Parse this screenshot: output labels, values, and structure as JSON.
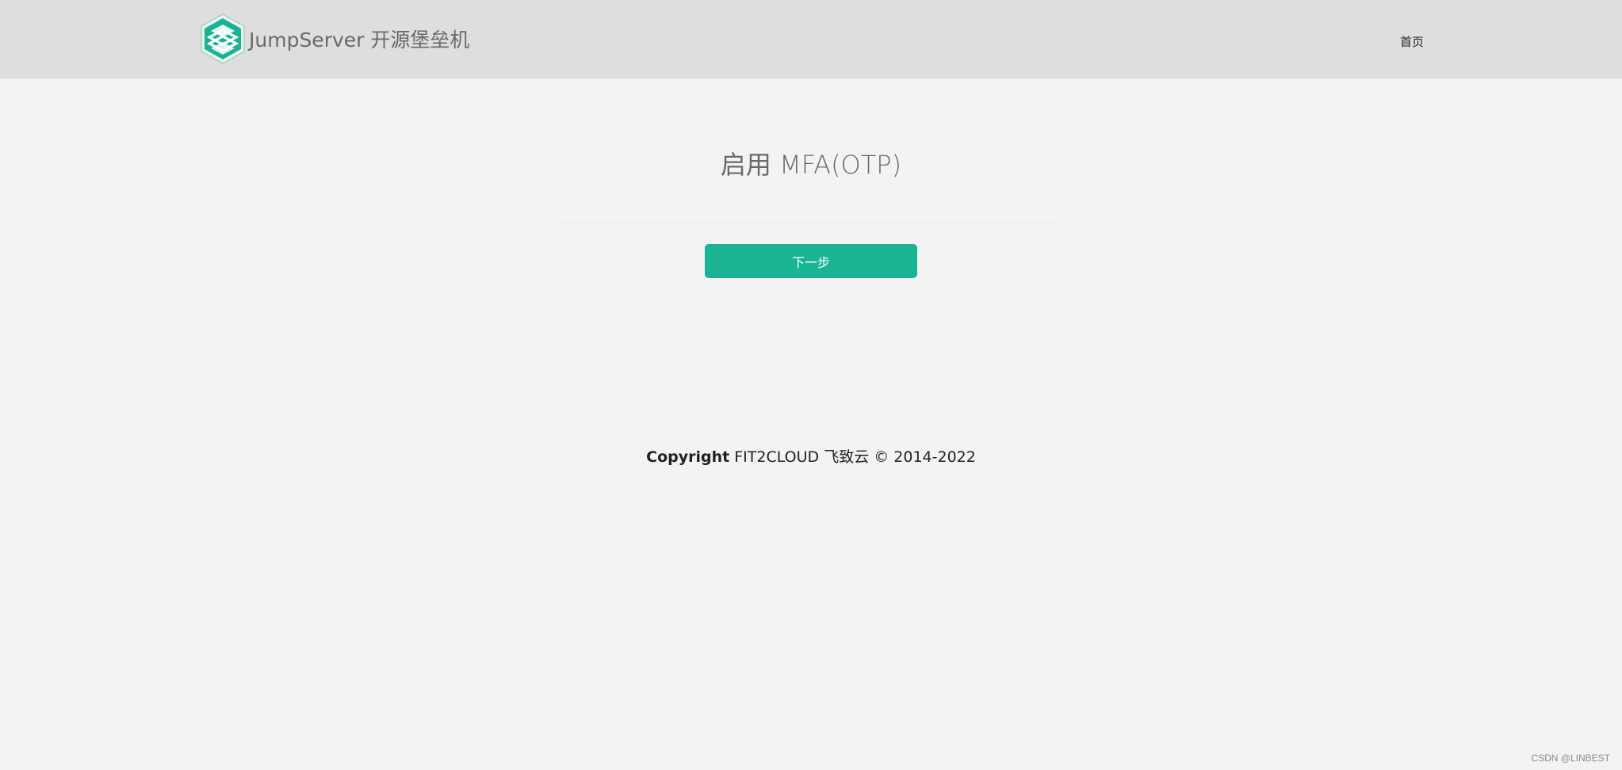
{
  "header": {
    "brand_text": "JumpServer 开源堡垒机",
    "nav_home": "首页",
    "logo_icon": "jumpserver-logo-icon",
    "background_color": "#dedede"
  },
  "main": {
    "title": "启用 MFA(OTP)",
    "next_button_label": "下一步",
    "accent_color": "#1ab394"
  },
  "footer": {
    "copyright_label": "Copyright",
    "copyright_text": " FIT2CLOUD 飞致云 © 2014-2022"
  },
  "watermark": {
    "text": "CSDN @LINBEST"
  }
}
